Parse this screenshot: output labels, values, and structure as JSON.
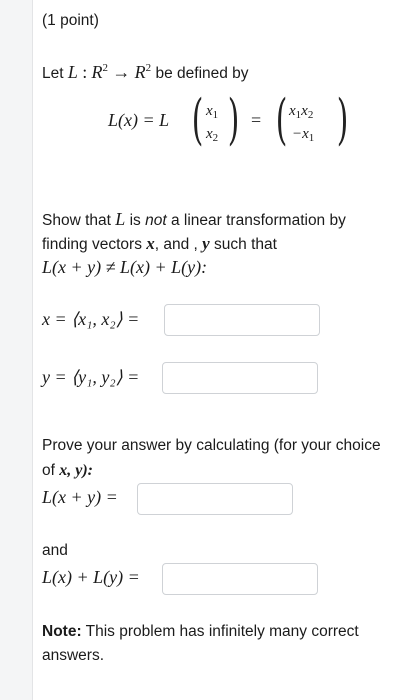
{
  "points": "(1 point)",
  "definition": {
    "let": "Let",
    "L": "L",
    "colon": ":",
    "R": "R",
    "exp": "2",
    "arrow": "→",
    "rest": "be defined by"
  },
  "matrix": {
    "lhs": "L(x) = L",
    "eq": "=",
    "in_top": "x",
    "in_top_sub": "1",
    "in_bot": "x",
    "in_bot_sub": "2",
    "out_top_a": "x",
    "out_top_a_sub": "1",
    "out_top_b": "x",
    "out_top_b_sub": "2",
    "out_bot": "−x",
    "out_bot_sub": "1"
  },
  "task": {
    "line1_a": "Show that",
    "line1_L": "L",
    "line1_b": "is",
    "line1_not": "not",
    "line1_c": "a linear transformation by",
    "line2_a": "finding vectors",
    "line2_x": "x",
    "line2_b": ", and ,",
    "line2_y": "y",
    "line2_c": "such that",
    "inequality": "L(x + y) ≠ L(x) + L(y):"
  },
  "fields": {
    "x_label": "x = ⟨x₁, x₂⟩ =",
    "y_label": "y = ⟨y₁, y₂⟩ =",
    "x_value": "",
    "y_value": "",
    "lxy_label": "L(x + y) =",
    "lxy_value": "",
    "and": "and",
    "lx_ly_label": "L(x) + L(y) =",
    "lx_ly_value": ""
  },
  "prove": {
    "line1": "Prove your answer by calculating (for your choice",
    "line2_a": "of",
    "line2_vars": "x, y):"
  },
  "note": {
    "label": "Note:",
    "text_line1": "This problem has infinitely many correct",
    "text_line2": "answers."
  }
}
